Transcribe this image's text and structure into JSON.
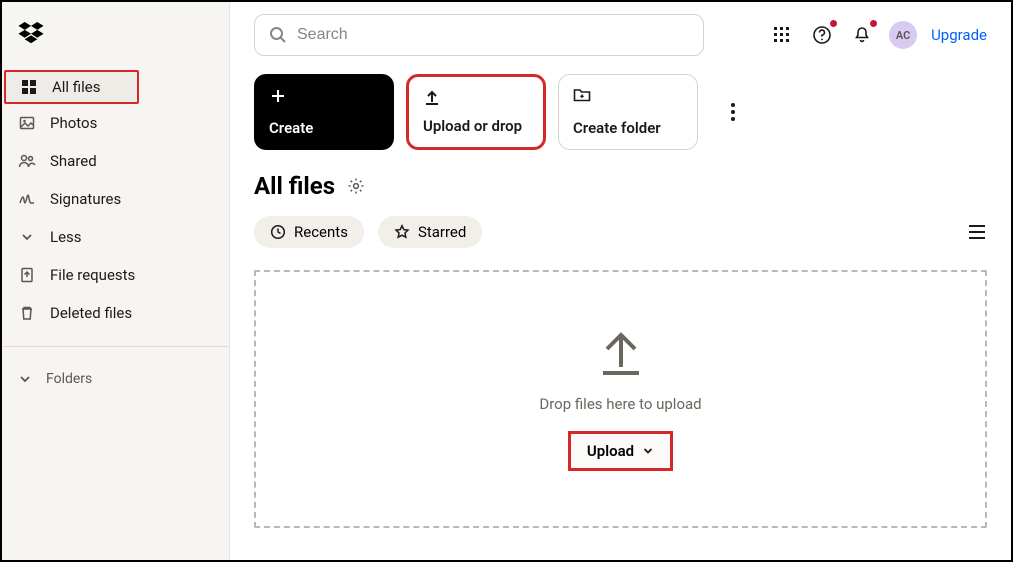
{
  "sidebar": {
    "items": [
      {
        "label": "All files"
      },
      {
        "label": "Photos"
      },
      {
        "label": "Shared"
      },
      {
        "label": "Signatures"
      },
      {
        "label": "Less"
      },
      {
        "label": "File requests"
      },
      {
        "label": "Deleted files"
      }
    ],
    "folders_label": "Folders"
  },
  "topbar": {
    "search_placeholder": "Search",
    "avatar_initials": "AC",
    "upgrade_label": "Upgrade"
  },
  "cards": {
    "create": "Create",
    "upload": "Upload or drop",
    "folder": "Create folder"
  },
  "heading": "All files",
  "chips": {
    "recents": "Recents",
    "starred": "Starred"
  },
  "dropzone": {
    "hint": "Drop files here to upload",
    "button": "Upload"
  }
}
